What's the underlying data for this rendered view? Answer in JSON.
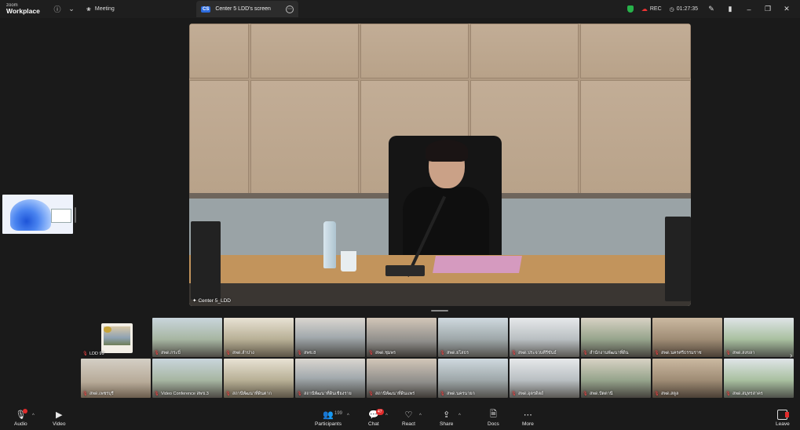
{
  "app": {
    "brand_top": "zoom",
    "brand_main": "Workplace"
  },
  "titlebar": {
    "meeting_tab_label": "Meeting",
    "share_tab_badge": "CS",
    "share_tab_label": "Center 5 LDD's screen",
    "rec_label": "REC",
    "timer": "01:27:35"
  },
  "stage": {
    "label": "Center 5_LDD"
  },
  "gallery": {
    "tiles": [
      {
        "label": "LDD 99",
        "muted": true
      },
      {
        "label": "สพด.กระบี่",
        "muted": true
      },
      {
        "label": "สพด.ลำปาง",
        "muted": true
      },
      {
        "label": "สพข.8",
        "muted": true
      },
      {
        "label": "สพด.ชุมพร",
        "muted": true
      },
      {
        "label": "สพด.ยโสธร",
        "muted": true
      },
      {
        "label": "สพด.ประจวบคีรีขันธ์",
        "muted": true
      },
      {
        "label": "สำนักงานพัฒนาที่ดิน",
        "muted": true
      },
      {
        "label": "สพด.นครศรีธรรมราช",
        "muted": true
      },
      {
        "label": "สพด.สงขลา",
        "muted": true
      },
      {
        "label": "สพด.เพชรบุรี",
        "muted": true
      },
      {
        "label": "Video Conference สพข.3",
        "muted": true
      },
      {
        "label": "สถานีพัฒนาที่ดินตาก",
        "muted": true
      },
      {
        "label": "สถานีพัฒนาที่ดินเชียงราย",
        "muted": true
      },
      {
        "label": "สถานีพัฒนาที่ดินแพร่",
        "muted": true
      },
      {
        "label": "สพด.นครนายก",
        "muted": true
      },
      {
        "label": "สพด.อุตรดิตถ์",
        "muted": true
      },
      {
        "label": "สพด.ปัตตานี",
        "muted": true
      },
      {
        "label": "สพด.สตูล",
        "muted": true
      },
      {
        "label": "สพด.สมุทรสาคร",
        "muted": true
      }
    ]
  },
  "toolbar": {
    "audio_label": "Audio",
    "video_label": "Video",
    "participants_label": "Participants",
    "participants_count": "199",
    "chat_label": "Chat",
    "chat_badge": "47",
    "react_label": "React",
    "share_label": "Share",
    "docs_label": "Docs",
    "more_label": "More",
    "leave_label": "Leave"
  },
  "colors": {
    "accent": "#2d6cdf",
    "danger": "#e02b2b",
    "secure": "#27b24a",
    "background": "#1a1a1a"
  }
}
